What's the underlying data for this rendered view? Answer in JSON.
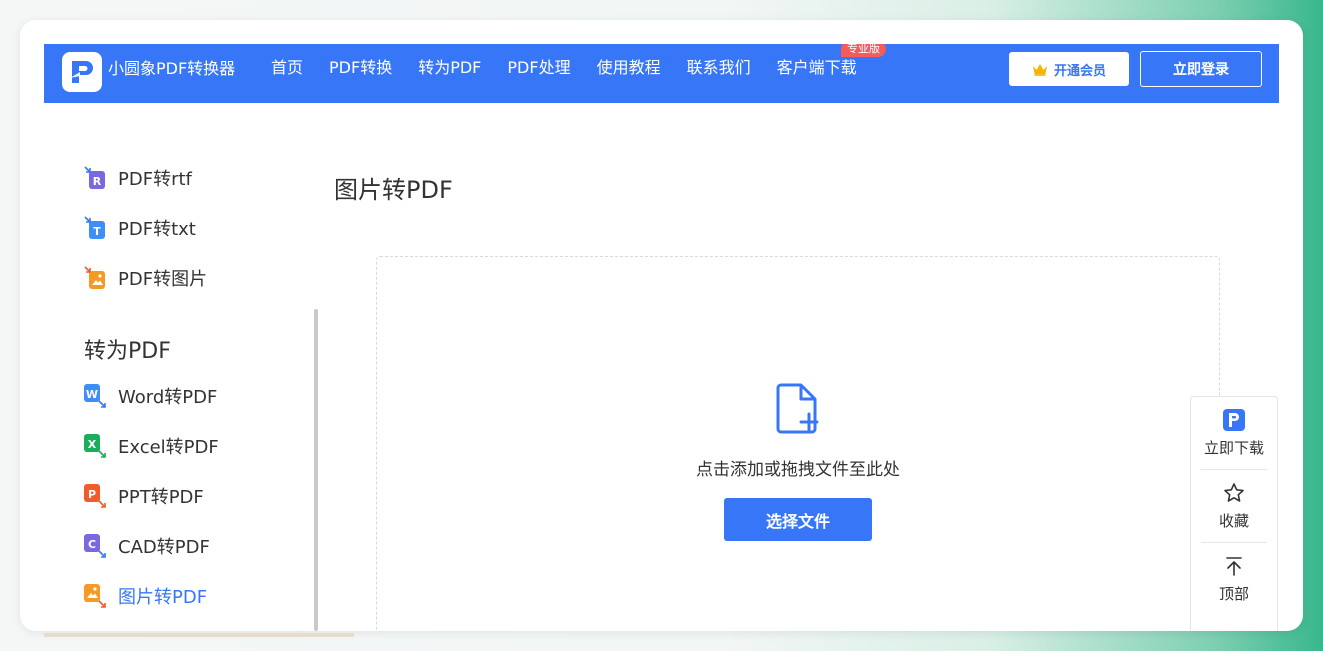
{
  "header": {
    "brand": "小圆象PDF转换器",
    "nav": [
      "首页",
      "PDF转换",
      "转为PDF",
      "PDF处理",
      "使用教程",
      "联系我们",
      "客户端下载"
    ],
    "pro_badge": "专业版",
    "vip_label": "开通会员",
    "login_label": "立即登录"
  },
  "sidebar": {
    "group1_items": [
      {
        "label": "PDF转rtf",
        "icon": "rtf-file-icon",
        "color": "#7b67e0"
      },
      {
        "label": "PDF转txt",
        "icon": "txt-file-icon",
        "color": "#3d8ef7"
      },
      {
        "label": "PDF转图片",
        "icon": "image-file-icon",
        "color": "#f59a23"
      }
    ],
    "heading": "转为PDF",
    "group2_items": [
      {
        "label": "Word转PDF",
        "icon": "word-file-icon",
        "color": "#3d8ef7"
      },
      {
        "label": "Excel转PDF",
        "icon": "excel-file-icon",
        "color": "#1aad5c"
      },
      {
        "label": "PPT转PDF",
        "icon": "ppt-file-icon",
        "color": "#f25c2a"
      },
      {
        "label": "CAD转PDF",
        "icon": "cad-file-icon",
        "color": "#7b67e0"
      },
      {
        "label": "图片转PDF",
        "icon": "image-file-icon",
        "color": "#f59a23",
        "active": true
      }
    ]
  },
  "main": {
    "title": "图片转PDF",
    "drop_text": "点击添加或拖拽文件至此处",
    "select_button": "选择文件"
  },
  "float_panel": {
    "download": "立即下载",
    "favorite": "收藏",
    "top": "顶部"
  },
  "colors": {
    "accent": "#3777f7",
    "badge": "#f45b5b"
  }
}
